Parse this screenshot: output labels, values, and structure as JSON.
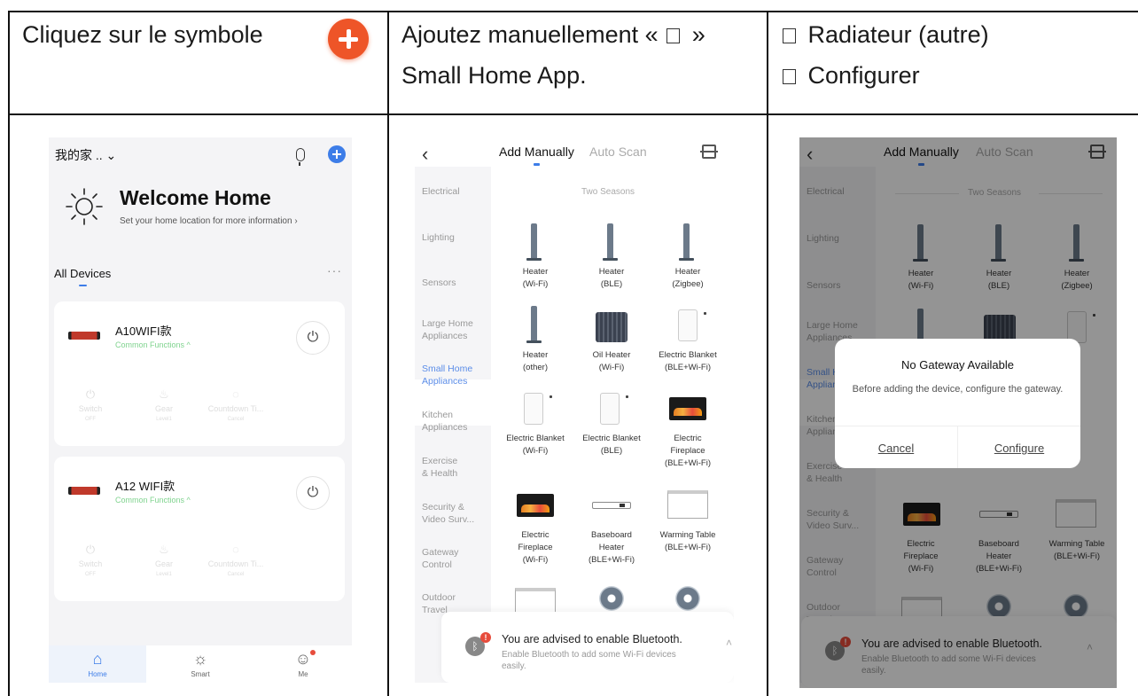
{
  "table": {
    "col1_text": "Cliquez sur le symbole",
    "col2_line1_pre": "Ajoutez manuellement «",
    "col2_line1_post": "»",
    "col2_line2": "Small Home App.",
    "col3_line1": "Radiateur (autre)",
    "col3_line2": "Configurer"
  },
  "phone_home": {
    "home_name": "我的家 .. ⌄",
    "welcome_title": "Welcome Home",
    "welcome_sub": "Set your home location for more information  ›",
    "all_devices": "All Devices",
    "more": "···",
    "devices": [
      {
        "name": "A10WIFI款",
        "sub": "Common Functions ^"
      },
      {
        "name": "A12 WIFI款",
        "sub": "Common Functions ^"
      }
    ],
    "functions": [
      {
        "label": "Switch",
        "state": "OFF"
      },
      {
        "label": "Gear",
        "state": "Level1"
      },
      {
        "label": "Countdown Ti...",
        "state": "Cancel"
      }
    ],
    "tabs": [
      "Home",
      "Smart",
      "Me"
    ]
  },
  "add_manually": {
    "tab_manual": "Add Manually",
    "tab_auto": "Auto Scan",
    "categories": [
      "Electrical",
      "Lighting",
      "Sensors",
      "Large Home\nAppliances",
      "Small Home\nAppliances",
      "Kitchen\nAppliances",
      "Exercise\n& Health",
      "Security &\nVideo Surv...",
      "Gateway\nControl",
      "Outdoor\nTravel"
    ],
    "section_title": "Two Seasons",
    "products": [
      "Heater\n(Wi-Fi)",
      "Heater\n(BLE)",
      "Heater\n(Zigbee)",
      "Heater\n(other)",
      "Oil Heater\n(Wi-Fi)",
      "Electric Blanket\n(BLE+Wi-Fi)",
      "Electric Blanket\n(Wi-Fi)",
      "Electric Blanket\n(BLE)",
      "Electric\nFireplace\n(BLE+Wi-Fi)",
      "Electric\nFireplace\n(Wi-Fi)",
      "Baseboard\nHeater\n(BLE+Wi-Fi)",
      "Warming Table\n(BLE+Wi-Fi)"
    ],
    "bt_alert": "!",
    "bt_title": "You are advised to enable Bluetooth.",
    "bt_sub": "Enable Bluetooth to add some Wi-Fi devices easily."
  },
  "dialog": {
    "title": "No Gateway Available",
    "message": "Before adding the device, configure the gateway.",
    "cancel": "Cancel",
    "configure": "Configure"
  },
  "icons": {
    "plus": "plus-circle-icon",
    "sun": "sun-icon",
    "bluetooth": "bluetooth-icon"
  },
  "colors": {
    "accent_orange": "#ee5528",
    "accent_blue": "#3d7de8",
    "green_sub": "#7fd38e"
  }
}
